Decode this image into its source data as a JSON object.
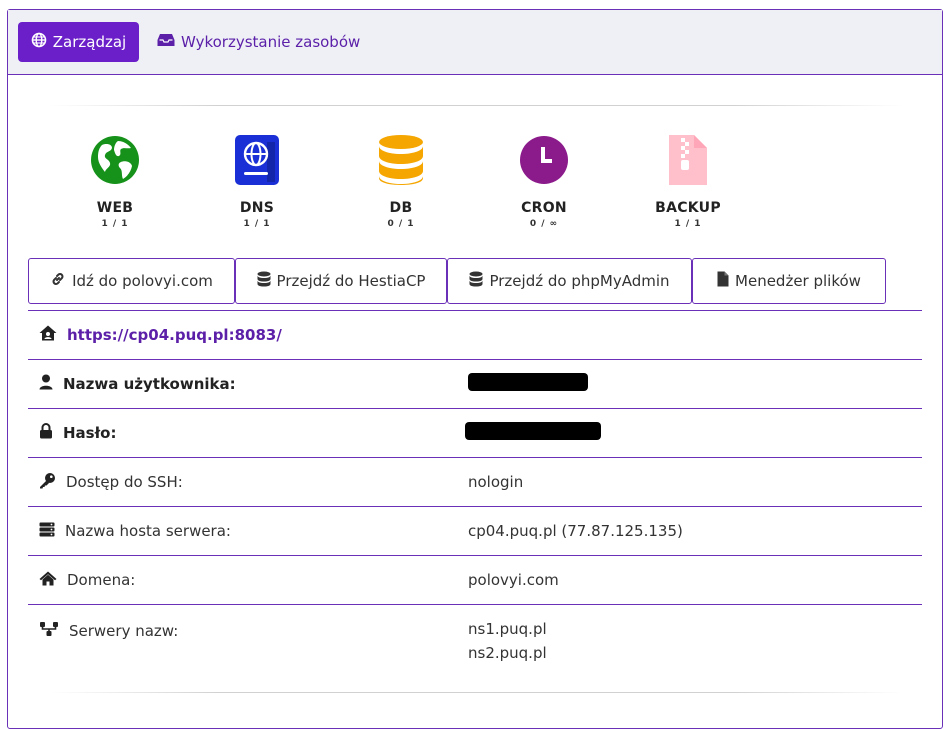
{
  "header": {
    "tabs": [
      {
        "label": "Zarządzaj",
        "active": true,
        "icon": "globe-icon"
      },
      {
        "label": "Wykorzystanie zasobów",
        "active": false,
        "icon": "inbox-icon"
      }
    ]
  },
  "stats": [
    {
      "name": "WEB",
      "count": "1 / 1",
      "icon": "globe-earth-icon",
      "color": "#16921b"
    },
    {
      "name": "DNS",
      "count": "1 / 1",
      "icon": "passport-icon",
      "color": "#1a2fd6"
    },
    {
      "name": "DB",
      "count": "0 / 1",
      "icon": "database-icon",
      "color": "#f5a600"
    },
    {
      "name": "CRON",
      "count": "0 / ∞",
      "icon": "clock-icon",
      "color": "#8b1a8b"
    },
    {
      "name": "BACKUP",
      "count": "1 / 1",
      "icon": "file-zipper-icon",
      "color": "#ffc0cb"
    }
  ],
  "actions": [
    {
      "label": "Idź do polovyi.com",
      "icon": "link-icon"
    },
    {
      "label": "Przejdź do HestiaCP",
      "icon": "database-small-icon"
    },
    {
      "label": "Przejdź do phpMyAdmin",
      "icon": "database-small-icon"
    },
    {
      "label": "Menedżer plików",
      "icon": "file-icon"
    }
  ],
  "panel_url": "https://cp04.puq.pl:8083/",
  "details": {
    "username": {
      "label": "Nazwa użytkownika:"
    },
    "password": {
      "label": "Hasło:"
    },
    "ssh": {
      "label": "Dostęp do SSH:",
      "value": "nologin"
    },
    "hostname": {
      "label": "Nazwa hosta serwera:",
      "value": "cp04.puq.pl (77.87.125.135)"
    },
    "domain": {
      "label": "Domena:",
      "value": "polovyi.com"
    },
    "nameservers": {
      "label": "Serwery nazw:",
      "values": [
        "ns1.puq.pl",
        "ns2.puq.pl"
      ]
    }
  },
  "colors": {
    "accent": "#6a1fc9",
    "border": "#6a30b8",
    "link": "#5b1fa8"
  }
}
